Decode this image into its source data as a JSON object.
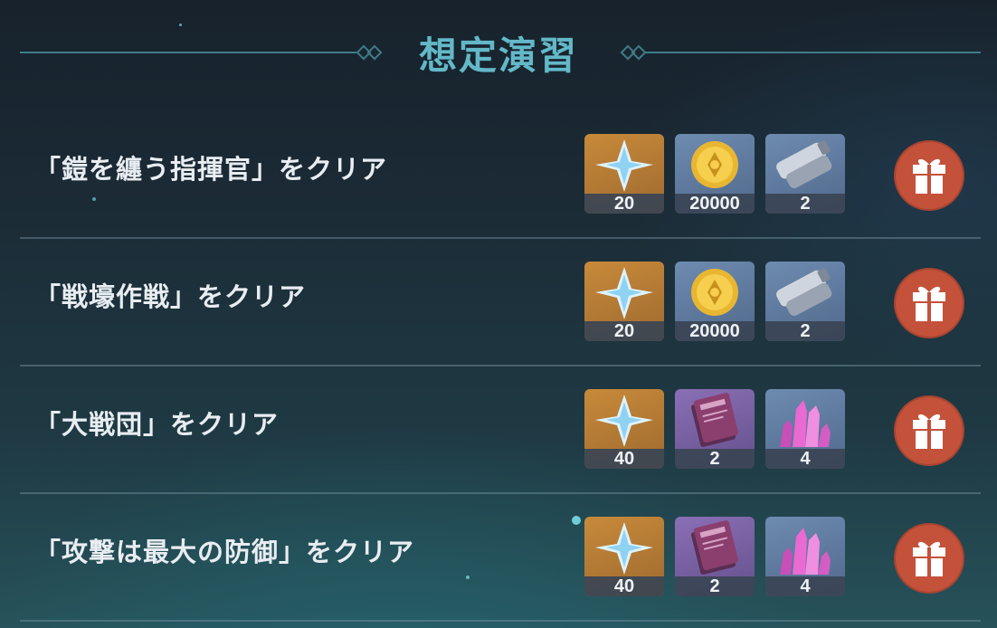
{
  "title": "想定演習",
  "rows": [
    {
      "label": "「鎧を纏う指揮官」をクリア",
      "rewards": [
        {
          "icon": "primogem-icon",
          "qty": "20",
          "rarity": "gold"
        },
        {
          "icon": "mora-coin-icon",
          "qty": "20000",
          "rarity": "blue"
        },
        {
          "icon": "mystic-enhancement-ore-icon",
          "qty": "2",
          "rarity": "blue"
        }
      ]
    },
    {
      "label": "「戦壕作戦」をクリア",
      "rewards": [
        {
          "icon": "primogem-icon",
          "qty": "20",
          "rarity": "gold"
        },
        {
          "icon": "mora-coin-icon",
          "qty": "20000",
          "rarity": "blue"
        },
        {
          "icon": "mystic-enhancement-ore-icon",
          "qty": "2",
          "rarity": "blue"
        }
      ]
    },
    {
      "label": "「大戦団」をクリア",
      "rewards": [
        {
          "icon": "primogem-icon",
          "qty": "40",
          "rarity": "gold"
        },
        {
          "icon": "heros-wit-book-icon",
          "qty": "2",
          "rarity": "purple"
        },
        {
          "icon": "crystal-cluster-icon",
          "qty": "4",
          "rarity": "blue"
        }
      ]
    },
    {
      "label": "「攻撃は最大の防御」をクリア",
      "rewards": [
        {
          "icon": "primogem-icon",
          "qty": "40",
          "rarity": "gold"
        },
        {
          "icon": "heros-wit-book-icon",
          "qty": "2",
          "rarity": "purple"
        },
        {
          "icon": "crystal-cluster-icon",
          "qty": "4",
          "rarity": "blue"
        }
      ]
    }
  ],
  "colors": {
    "title": "#63b8c8",
    "gift_button": "#c4513a",
    "gold_frame": "#c88a3a",
    "blue_frame": "#6d8bb0",
    "purple_frame": "#8a6fb4"
  }
}
